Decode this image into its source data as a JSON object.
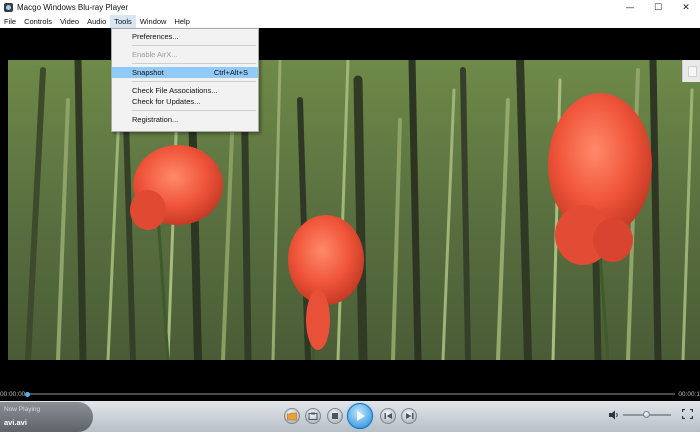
{
  "window": {
    "title": "Macgo Windows Blu-ray Player",
    "minimize_icon": "—",
    "maximize_icon": "☐",
    "close_icon": "✕"
  },
  "menubar": {
    "items": [
      "File",
      "Controls",
      "Video",
      "Audio",
      "Tools",
      "Window",
      "Help"
    ],
    "open_menu": "Tools"
  },
  "tools_menu": {
    "preferences": "Preferences...",
    "enable_airx": "Enable AirX...",
    "snapshot": "Snapshot",
    "snapshot_shortcut": "Ctrl+Alt+S",
    "check_file_associations": "Check File Associations...",
    "check_for_updates": "Check for Updates...",
    "registration": "Registration..."
  },
  "playback": {
    "time_elapsed": "00:00:00",
    "time_total": "00:00:1",
    "progress": 0.0,
    "volume": 0.5
  },
  "now_playing": {
    "label": "Now Playing",
    "file": "avi.avi"
  },
  "colors": {
    "menu_highlight": "#91c9f7",
    "play_button": "#1a88d8",
    "progress_knob": "#4fb3ff"
  },
  "icons": [
    "folder-icon",
    "disc-icon",
    "stop-icon",
    "play-icon",
    "previous-icon",
    "next-icon",
    "volume-icon",
    "fullscreen-icon"
  ]
}
